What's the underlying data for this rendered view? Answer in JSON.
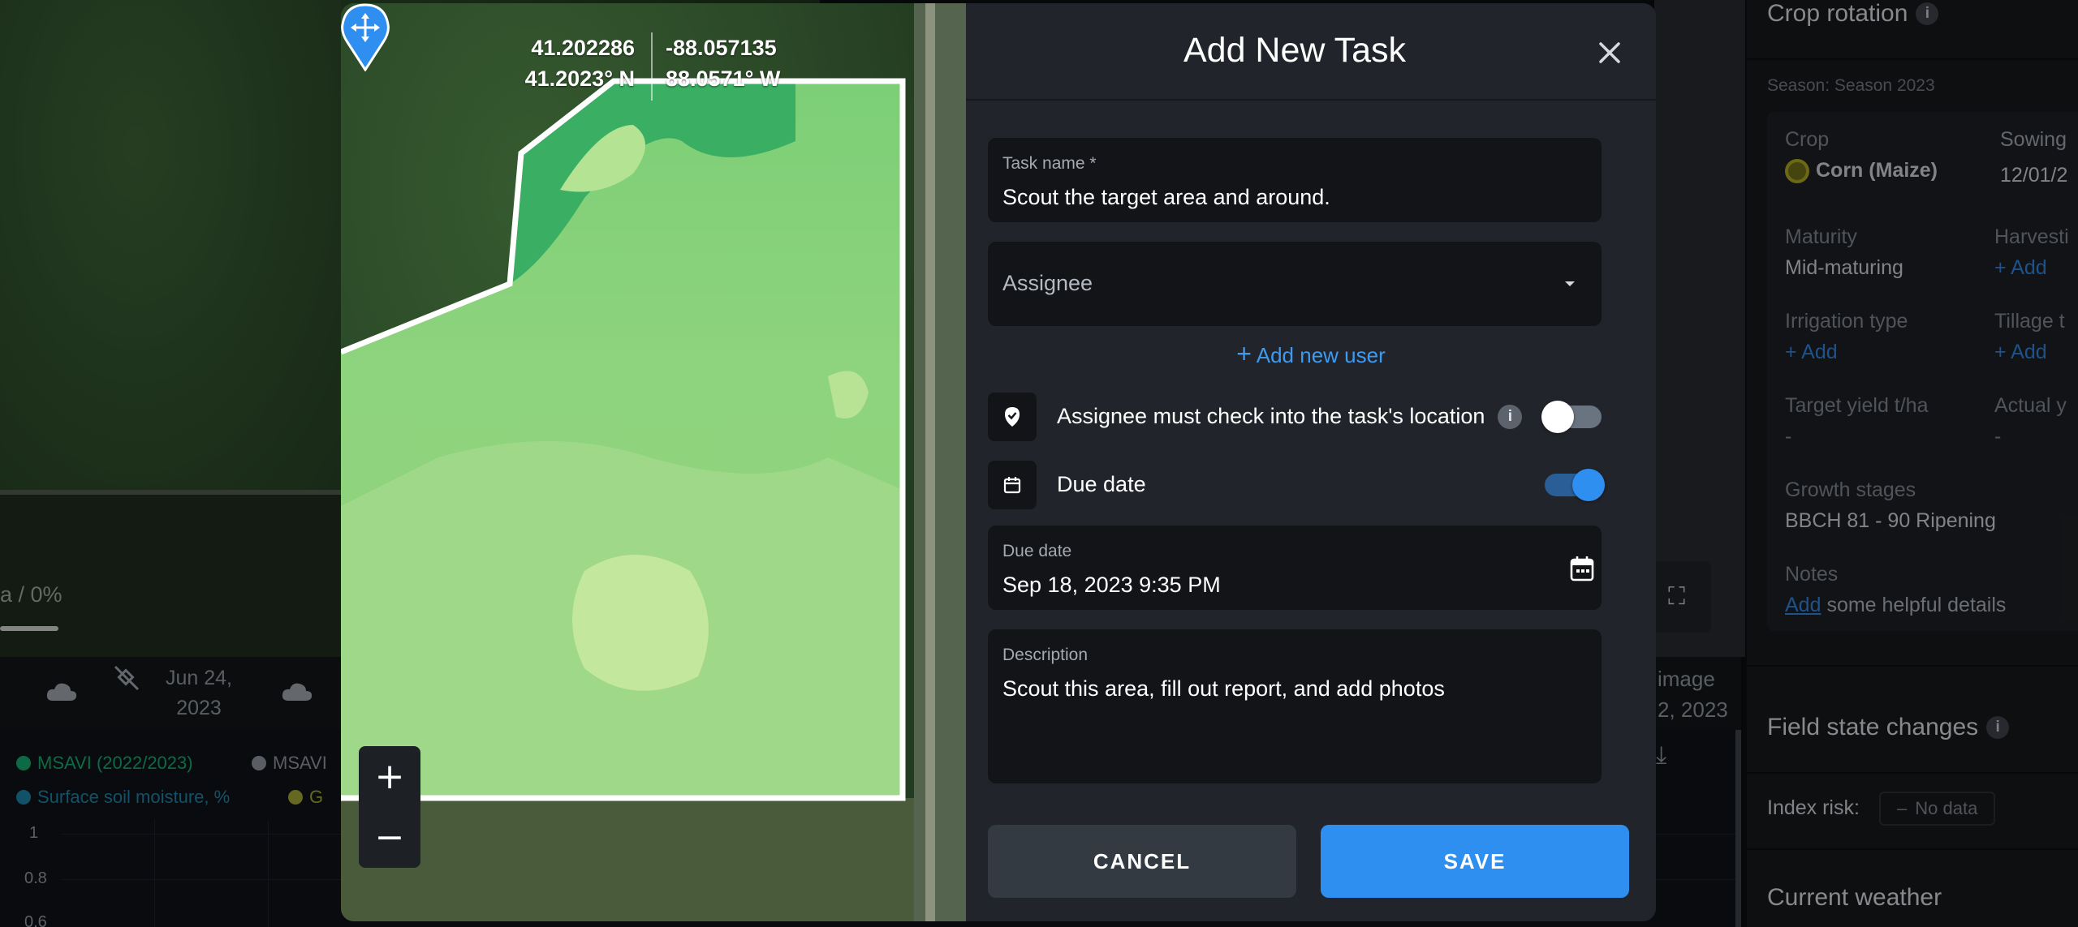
{
  "background": {
    "progress_text": "a / 0%",
    "timeline": [
      {
        "date": "Jun 24,",
        "year": "2023"
      }
    ],
    "image_label": {
      "line1": "image",
      "line2": "2, 2023"
    },
    "legend": [
      {
        "label": "MSAVI (2022/2023)",
        "color": "#16a36a"
      },
      {
        "label": "MSAVI",
        "color": "#8b9098"
      },
      {
        "label": "Surface soil moisture, %",
        "color": "#1d7fa0"
      },
      {
        "label": "G",
        "color": "#9aa032"
      }
    ],
    "y_ticks": [
      "1",
      "0.8",
      "0.6"
    ]
  },
  "right_panel": {
    "crop_rotation_title": "Crop rotation",
    "season": "Season: Season 2023",
    "crop_label": "Crop",
    "crop_value": "Corn (Maize)",
    "sowing_label": "Sowing",
    "sowing_value": "12/01/2",
    "maturity_label": "Maturity",
    "maturity_value": "Mid-maturing",
    "harvesting_label": "Harvesti",
    "harvesting_add": "+ Add",
    "irrigation_label": "Irrigation type",
    "irrigation_add": "+ Add",
    "tillage_label": "Tillage t",
    "tillage_add": "+ Add",
    "target_yield_label": "Target yield t/ha",
    "target_yield_value": "-",
    "actual_yield_label": "Actual y",
    "actual_yield_value": "-",
    "growth_label": "Growth stages",
    "growth_value": "BBCH 81 - 90 Ripening",
    "notes_label": "Notes",
    "notes_link": "Add",
    "notes_text": "some helpful details",
    "field_state_title": "Field state changes",
    "index_risk_label": "Index risk:",
    "index_risk_value": "No data",
    "current_weather_title": "Current weather"
  },
  "map": {
    "lat": "41.202286",
    "lat_dms": "41.2023° N",
    "lon": "-88.057135",
    "lon_dms": "88.0571° W"
  },
  "dialog": {
    "title": "Add New Task",
    "task_name_label": "Task name *",
    "task_name_value": "Scout the target area and around.",
    "assignee_placeholder": "Assignee",
    "add_user_label": "Add new user",
    "checkin_label": "Assignee must check into the task's location",
    "checkin_enabled": false,
    "due_toggle_label": "Due date",
    "due_enabled": true,
    "due_field_label": "Due date",
    "due_value": "Sep 18, 2023 9:35 PM",
    "description_label": "Description",
    "description_value": "Scout this area, fill out report, and add photos",
    "cancel_label": "CANCEL",
    "save_label": "SAVE"
  },
  "colors": {
    "accent": "#2f8ff0",
    "link": "#3d9af0",
    "toggle_off_track": "#5a6470",
    "field_bg": "#121418"
  }
}
